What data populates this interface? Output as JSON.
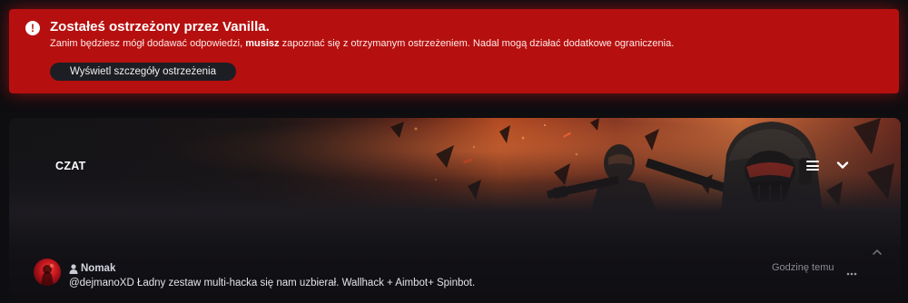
{
  "warning": {
    "icon": "exclamation-circle-icon",
    "title": "Zostałeś ostrzeżony przez Vanilla.",
    "text_before": "Zanim będziesz mógł dodawać odpowiedzi, ",
    "text_bold": "musisz",
    "text_after": " zapoznać się z otrzymanym ostrzeżeniem. Nadal mogą działać dodatkowe ograniczenia.",
    "button_label": "Wyświetl szczegóły ostrzeżenia",
    "color": "#b5100f"
  },
  "chat": {
    "title": "CZAT",
    "icons": [
      "menu-icon",
      "chevron-down-icon",
      "chevron-up-icon"
    ],
    "message": {
      "author": "Nomak",
      "text": "@dejmanoXD Ładny zestaw multi-hacka się nam uzbierał. Wallhack + Aimbot+ Spinbot.",
      "time": "Godzinę temu",
      "more_icon": "ellipsis-icon"
    }
  }
}
